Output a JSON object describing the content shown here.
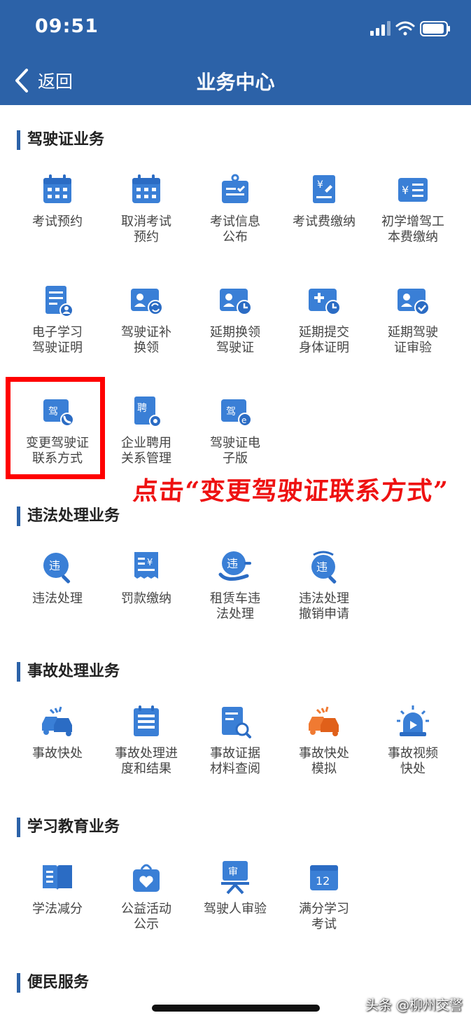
{
  "status_bar": {
    "time": "09:51"
  },
  "nav": {
    "back_label": "返回",
    "title": "业务中心"
  },
  "colors": {
    "header": "#2c62a8",
    "icon_blue": "#3a7fd6",
    "icon_orange": "#f07a32",
    "highlight": "#ff0000"
  },
  "sections": {
    "license": {
      "title": "驾驶证业务",
      "items": [
        {
          "label": "考试预约",
          "icon": "calendar-icon"
        },
        {
          "label": "取消考试\n预约",
          "icon": "calendar-icon"
        },
        {
          "label": "考试信息\n公布",
          "icon": "notice-board-icon"
        },
        {
          "label": "考试费缴纳",
          "icon": "fee-document-icon"
        },
        {
          "label": "初学增驾工\n本费缴纳",
          "icon": "fee-card-icon"
        },
        {
          "label": "电子学习\n驾驶证明",
          "icon": "document-user-icon"
        },
        {
          "label": "驾驶证补\n换领",
          "icon": "id-card-refresh-icon"
        },
        {
          "label": "延期换领\n驾驶证",
          "icon": "id-card-clock-icon"
        },
        {
          "label": "延期提交\n身体证明",
          "icon": "medical-clock-icon"
        },
        {
          "label": "延期驾驶\n证审验",
          "icon": "id-card-check-icon"
        },
        {
          "label": "变更驾驶证\n联系方式",
          "icon": "license-phone-icon"
        },
        {
          "label": "企业聘用\n关系管理",
          "icon": "hire-document-icon"
        },
        {
          "label": "驾驶证电\n子版",
          "icon": "license-electronic-icon"
        }
      ]
    },
    "violation": {
      "title": "违法处理业务",
      "items": [
        {
          "label": "违法处理",
          "icon": "violation-search-icon"
        },
        {
          "label": "罚款缴纳",
          "icon": "fine-receipt-icon"
        },
        {
          "label": "租赁车违\n法处理",
          "icon": "rental-violation-icon"
        },
        {
          "label": "违法处理\n撤销申请",
          "icon": "violation-revoke-icon"
        }
      ]
    },
    "accident": {
      "title": "事故处理业务",
      "items": [
        {
          "label": "事故快处",
          "icon": "car-crash-icon"
        },
        {
          "label": "事故处理进\n度和结果",
          "icon": "progress-list-icon"
        },
        {
          "label": "事故证据\n材料查阅",
          "icon": "evidence-search-icon"
        },
        {
          "label": "事故快处\n模拟",
          "icon": "car-crash-orange-icon"
        },
        {
          "label": "事故视频\n快处",
          "icon": "siren-video-icon"
        }
      ]
    },
    "education": {
      "title": "学习教育业务",
      "items": [
        {
          "label": "学法减分",
          "icon": "open-book-icon"
        },
        {
          "label": "公益活动\n公示",
          "icon": "heart-bag-icon"
        },
        {
          "label": "驾驶人审验",
          "icon": "review-board-icon"
        },
        {
          "label": "满分学习\n考试",
          "icon": "calendar-12-icon"
        }
      ]
    },
    "convenience": {
      "title": "便民服务"
    }
  },
  "annotation": {
    "text": "点击“变更驾驶证联系方式”"
  },
  "watermark": {
    "text": "头条 @柳州交警"
  }
}
